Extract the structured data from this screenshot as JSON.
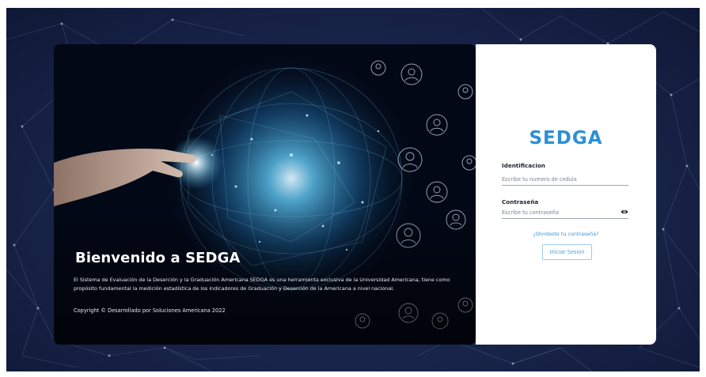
{
  "hero": {
    "title": "Bienvenido a SEDGA",
    "description": "El Sistema de Evaluación de la Deserción y la Graduación Americana SEDGA es una herramienta exclusiva de la Universidad Americana, tiene como propósito fundamental la medición estadística de los indicadores de Graduación y Deserción de la Americana a nivel nacional.",
    "copyright": "Copyright © Desarrollado por Soluciones Americana 2022"
  },
  "login": {
    "logo": "SEDGA",
    "id_label": "Identificacion",
    "id_placeholder": "Escribe tu numero de cedula",
    "id_value": "",
    "password_label": "Contraseña",
    "password_placeholder": "Escribe tu contraseña",
    "password_value": "",
    "forgot_link": "¿Olvidaste tu contraseña?",
    "submit_label": "Iniciar Sesion"
  },
  "icons": {
    "password_toggle": "eye-icon",
    "people": "person-icon"
  },
  "colors": {
    "brand": "#2c8fd6",
    "link": "#3d92d4",
    "background": "#18244a"
  }
}
